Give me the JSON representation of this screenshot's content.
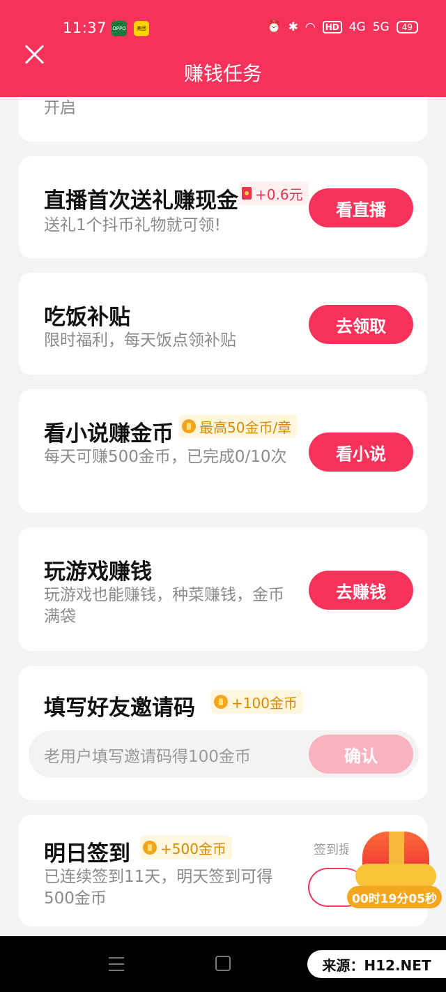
{
  "status_bar": {
    "time": "11:37",
    "app_icon_1": "OPPO",
    "app_icon_2": "美团",
    "hd": "HD",
    "net_4g": "4G",
    "net_5g": "5G",
    "battery": "49"
  },
  "header": {
    "title": "赚钱任务",
    "close_icon": "close-icon"
  },
  "tasks": [
    {
      "subtitle": "开启"
    },
    {
      "title": "直播首次送礼赚现金",
      "badge": "+0.6元",
      "subtitle": "送礼1个抖币礼物就可领!",
      "button": "看直播"
    },
    {
      "title": "吃饭补贴",
      "subtitle": "限时福利，每天饭点领补贴",
      "button": "去领取"
    },
    {
      "title": "看小说赚金币",
      "badge": "最高50金币/章",
      "subtitle": "每天可赚500金币，已完成0/10次",
      "button": "看小说"
    },
    {
      "title": "玩游戏赚钱",
      "subtitle": "玩游戏也能赚钱，种菜赚钱，金币满袋",
      "button": "去赚钱"
    }
  ],
  "invite": {
    "title": "填写好友邀请码",
    "badge": "+100金币",
    "placeholder": "老用户填写邀请码得100金币",
    "button": "确认"
  },
  "sign": {
    "title": "明日签到",
    "badge": "+500金币",
    "subtitle": "已连续签到11天，明天签到可得500金币",
    "label": "签到提醒",
    "timer": "00时19分05秒"
  },
  "watermark": "来源：H12.NET",
  "colors": {
    "accent": "#f5335a",
    "coin": "#f3a51c",
    "badge_text": "#d98b00"
  }
}
